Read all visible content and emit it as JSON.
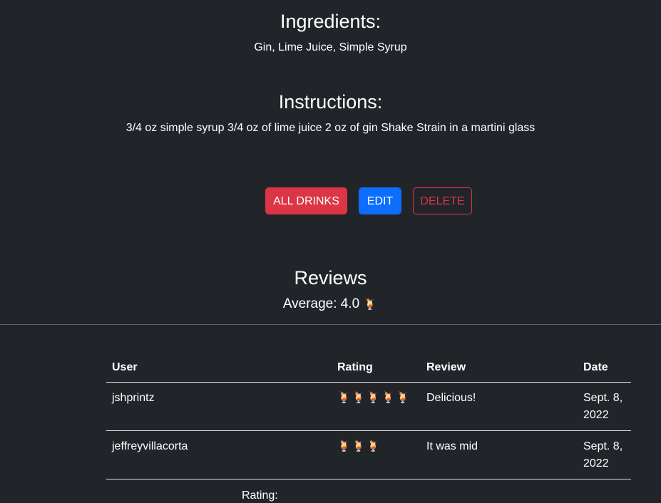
{
  "ingredients": {
    "heading": "Ingredients:",
    "text": "Gin, Lime Juice, Simple Syrup"
  },
  "instructions": {
    "heading": "Instructions:",
    "text": "3/4 oz simple syrup 3/4 oz of lime juice 2 oz of gin Shake Strain in a martini glass"
  },
  "buttons": {
    "all_drinks": "ALL DRINKS",
    "edit": "EDIT",
    "delete": "DELETE"
  },
  "reviews": {
    "heading": "Reviews",
    "average_label": "Average: 4.0",
    "average_icon": "🍹",
    "columns": [
      "User",
      "Rating",
      "Review",
      "Date"
    ],
    "rows": [
      {
        "user": "jshprintz",
        "rating": "🍹🍹🍹🍹🍹",
        "rating_value": 5,
        "review": "Delicious!",
        "date_line1": "Sept. 8,",
        "date_line2": "2022"
      },
      {
        "user": "jeffreyvillacorta",
        "rating": "🍹🍹🍹",
        "rating_value": 3,
        "review": "It was mid",
        "date_line1": "Sept. 8,",
        "date_line2": "2022"
      }
    ],
    "form_rating_label": "Rating:"
  },
  "colors": {
    "background": "#212529",
    "danger": "#dc3545",
    "primary": "#0d6efd"
  }
}
